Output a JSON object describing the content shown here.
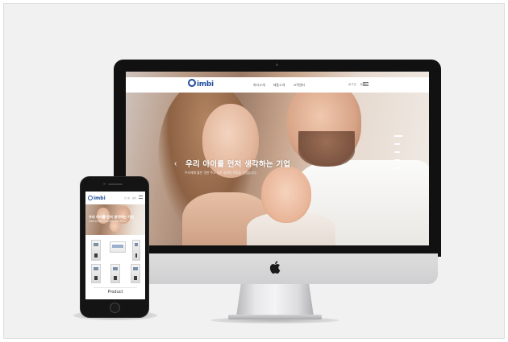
{
  "desktop_site": {
    "logo": "imbi",
    "nav": [
      "회사소개",
      "제품소개",
      "고객센터"
    ],
    "header_util": [
      "로그인",
      "회원"
    ],
    "hero": {
      "title": "우리 아이를 먼저 생각하는 기업",
      "subtitle": "우리에게 좋은 것만 주고 싶은 엄마의 마음을 담았습니다.",
      "slides": 5,
      "active_slide": 1
    }
  },
  "mobile_site": {
    "logo": "imbi",
    "nav": [
      "로그인",
      "회원"
    ],
    "hero_title": "우리 아이를 먼저 생각하는 기업",
    "hero_subtitle": "우리에게 좋은 것만 주고 싶은 엄마의 마음을 담았습니다.",
    "section_title": "Product"
  },
  "colors": {
    "brand": "#1f4e9c",
    "background": "#f1f1f2",
    "device_bezel": "#111111",
    "text_white": "#ffffff"
  },
  "icons": [
    "apple-logo-icon",
    "hamburger-menu-icon",
    "chevron-left-icon",
    "chevron-right-icon"
  ]
}
